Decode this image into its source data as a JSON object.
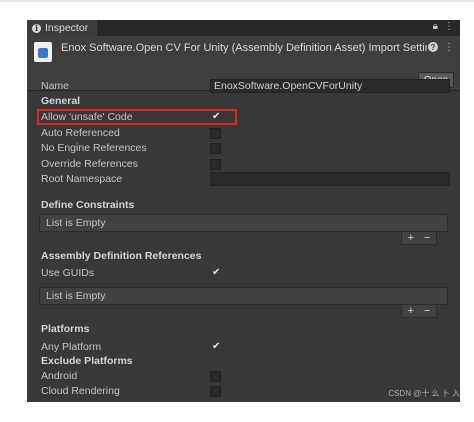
{
  "tab": {
    "label": "Inspector"
  },
  "header": {
    "title": "Enox Software.Open CV For Unity (Assembly Definition Asset) Import Settin",
    "open_label": "Open"
  },
  "fields": {
    "name_label": "Name",
    "name_value": "EnoxSoftware.OpenCVForUnity",
    "general": "General",
    "allow_unsafe": "Allow 'unsafe' Code",
    "auto_referenced": "Auto Referenced",
    "no_engine_refs": "No Engine References",
    "override_refs": "Override References",
    "root_namespace": "Root Namespace"
  },
  "define_constraints": {
    "heading": "Define Constraints",
    "empty": "List is Empty"
  },
  "assembly_refs": {
    "heading": "Assembly Definition References",
    "use_guids": "Use GUIDs",
    "empty": "List is Empty"
  },
  "platforms": {
    "heading": "Platforms",
    "any_platform": "Any Platform",
    "exclude": "Exclude Platforms",
    "android": "Android",
    "cloud_rendering": "Cloud Rendering"
  },
  "glyphs": {
    "check": "✔",
    "plus": "+",
    "minus": "−",
    "lock": "🔒",
    "kebab": "⋮",
    "help": "?",
    "info": "i"
  },
  "watermark": "CSDN @十 么 卜 入"
}
